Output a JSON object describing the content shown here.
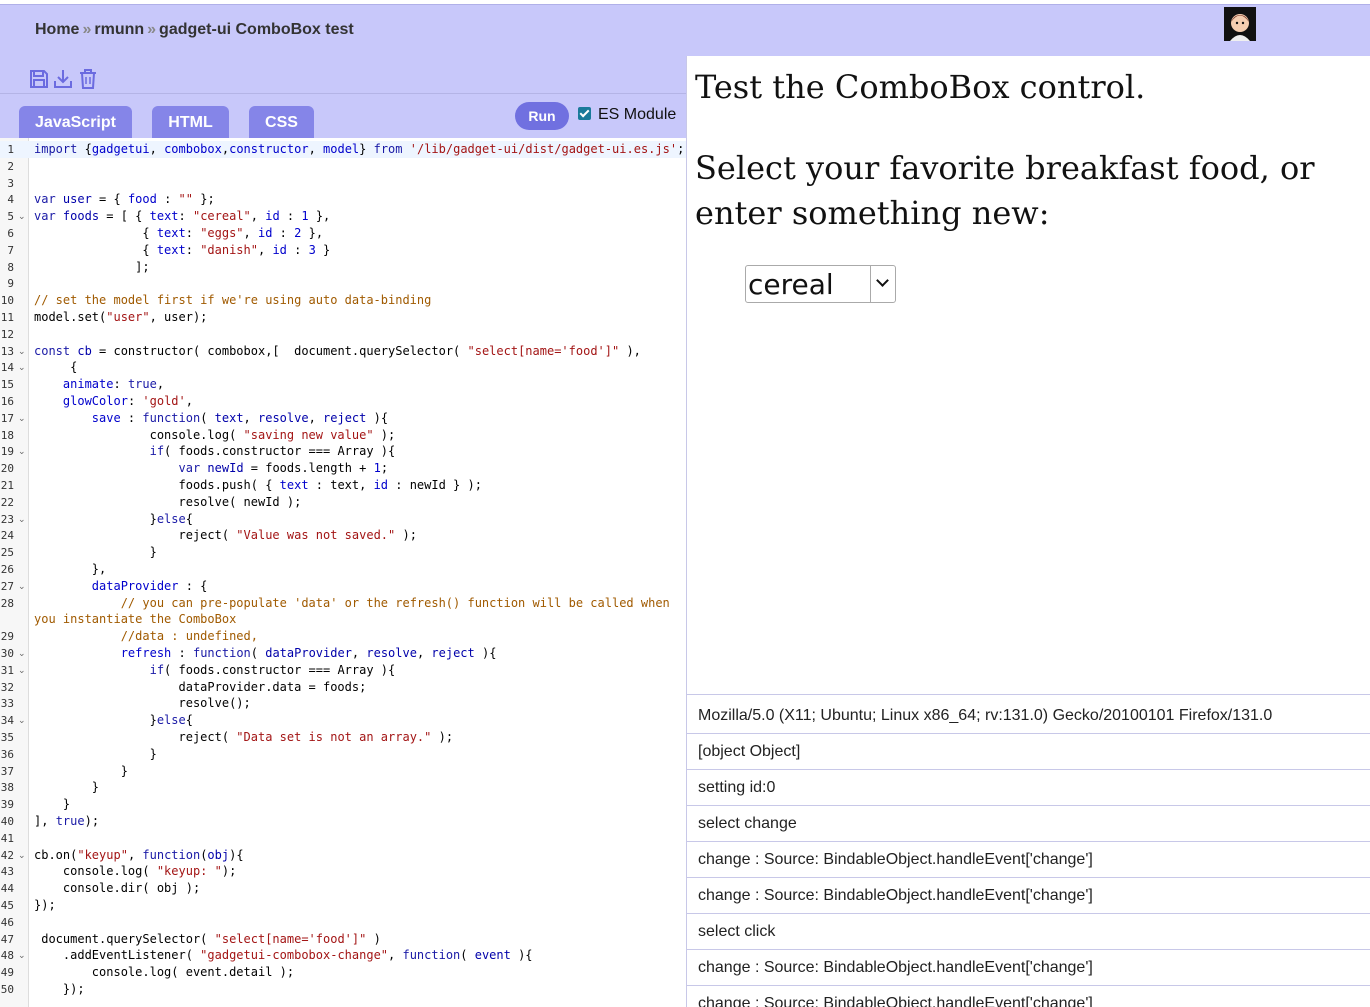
{
  "breadcrumb": {
    "home": "Home",
    "user": "rmunn",
    "title": "gadget-ui ComboBox test",
    "sep": "»"
  },
  "icons": {
    "save": "save-icon",
    "download": "download-icon",
    "delete": "trash-icon"
  },
  "tabs": [
    {
      "label": "JavaScript"
    },
    {
      "label": "HTML"
    },
    {
      "label": "CSS"
    }
  ],
  "run_label": "Run",
  "es_module_label": "ES Module",
  "es_module_checked": true,
  "code_lines": [
    {
      "n": "1",
      "f": "",
      "h": "<span class='k'>import</span> {<span class='n'>gadgetui</span>, <span class='n'>combobox</span>,<span class='n'>constructor</span>, <span class='n'>model</span>} <span class='k'>from</span> <span class='s'>'/lib/gadget-ui/dist/gadget-ui.es.js'</span>;"
    },
    {
      "n": "2",
      "f": "",
      "h": ""
    },
    {
      "n": "3",
      "f": "",
      "h": ""
    },
    {
      "n": "4",
      "f": "",
      "h": "<span class='k'>var</span> <span class='v'>user</span> = { <span class='n'>food</span> : <span class='s'>\"\"</span> };"
    },
    {
      "n": "5",
      "f": "⌄",
      "h": "<span class='k'>var</span> <span class='v'>foods</span> = [ { <span class='n'>text</span>: <span class='s'>\"cereal\"</span>, <span class='n'>id</span> : <span class='n'>1</span> },"
    },
    {
      "n": "6",
      "f": "",
      "h": "               { <span class='n'>text</span>: <span class='s'>\"eggs\"</span>, <span class='n'>id</span> : <span class='n'>2</span> },"
    },
    {
      "n": "7",
      "f": "",
      "h": "               { <span class='n'>text</span>: <span class='s'>\"danish\"</span>, <span class='n'>id</span> : <span class='n'>3</span> }"
    },
    {
      "n": "8",
      "f": "",
      "h": "              ];"
    },
    {
      "n": "9",
      "f": "",
      "h": ""
    },
    {
      "n": "10",
      "f": "",
      "h": "<span class='c'>// set the model first if we're using auto data-binding</span>"
    },
    {
      "n": "11",
      "f": "",
      "h": "model.set(<span class='s'>\"user\"</span>, user);"
    },
    {
      "n": "12",
      "f": "",
      "h": ""
    },
    {
      "n": "13",
      "f": "⌄",
      "h": "<span class='k'>const</span> <span class='v'>cb</span> = constructor( combobox,[  document.querySelector( <span class='s'>\"select[name='food']\"</span> ),"
    },
    {
      "n": "14",
      "f": "⌄",
      "h": "     {"
    },
    {
      "n": "15",
      "f": "",
      "h": "    <span class='n'>animate</span>: <span class='k'>true</span>,"
    },
    {
      "n": "16",
      "f": "",
      "h": "    <span class='n'>glowColor</span>: <span class='s'>'gold'</span>,"
    },
    {
      "n": "17",
      "f": "⌄",
      "h": "        <span class='n'>save</span> : <span class='k'>function</span>( <span class='v'>text</span>, <span class='v'>resolve</span>, <span class='v'>reject</span> ){"
    },
    {
      "n": "18",
      "f": "",
      "h": "                console.log( <span class='s'>\"saving new value\"</span> );"
    },
    {
      "n": "19",
      "f": "⌄",
      "h": "                <span class='k'>if</span>( foods.constructor === Array ){"
    },
    {
      "n": "20",
      "f": "",
      "h": "                    <span class='k'>var</span> <span class='v'>newId</span> = foods.length + <span class='n'>1</span>;"
    },
    {
      "n": "21",
      "f": "",
      "h": "                    foods.push( { <span class='n'>text</span> : text, <span class='n'>id</span> : newId } );"
    },
    {
      "n": "22",
      "f": "",
      "h": "                    resolve( newId );"
    },
    {
      "n": "23",
      "f": "⌄",
      "h": "                }<span class='k'>else</span>{"
    },
    {
      "n": "24",
      "f": "",
      "h": "                    reject( <span class='s'>\"Value was not saved.\"</span> );"
    },
    {
      "n": "25",
      "f": "",
      "h": "                }"
    },
    {
      "n": "26",
      "f": "",
      "h": "        },"
    },
    {
      "n": "27",
      "f": "⌄",
      "h": "        <span class='n'>dataProvider</span> : {"
    },
    {
      "n": "28",
      "f": "",
      "h": "            <span class='c'>// you can pre-populate 'data' or the refresh() function will be called when</span>"
    },
    {
      "n": "",
      "f": "",
      "h": "<span class='c'>you instantiate the ComboBox</span>"
    },
    {
      "n": "29",
      "f": "",
      "h": "            <span class='c'>//data : undefined,</span>"
    },
    {
      "n": "30",
      "f": "⌄",
      "h": "            <span class='n'>refresh</span> : <span class='k'>function</span>( <span class='v'>dataProvider</span>, <span class='v'>resolve</span>, <span class='v'>reject</span> ){"
    },
    {
      "n": "31",
      "f": "⌄",
      "h": "                <span class='k'>if</span>( foods.constructor === Array ){"
    },
    {
      "n": "32",
      "f": "",
      "h": "                    dataProvider.data = foods;"
    },
    {
      "n": "33",
      "f": "",
      "h": "                    resolve();"
    },
    {
      "n": "34",
      "f": "⌄",
      "h": "                }<span class='k'>else</span>{"
    },
    {
      "n": "35",
      "f": "",
      "h": "                    reject( <span class='s'>\"Data set is not an array.\"</span> );"
    },
    {
      "n": "36",
      "f": "",
      "h": "                }"
    },
    {
      "n": "37",
      "f": "",
      "h": "            }"
    },
    {
      "n": "38",
      "f": "",
      "h": "        }"
    },
    {
      "n": "39",
      "f": "",
      "h": "    }"
    },
    {
      "n": "40",
      "f": "",
      "h": "], <span class='k'>true</span>);"
    },
    {
      "n": "41",
      "f": "",
      "h": ""
    },
    {
      "n": "42",
      "f": "⌄",
      "h": "cb.on(<span class='s'>\"keyup\"</span>, <span class='k'>function</span>(<span class='v'>obj</span>){"
    },
    {
      "n": "43",
      "f": "",
      "h": "    console.log( <span class='s'>\"keyup: \"</span>);"
    },
    {
      "n": "44",
      "f": "",
      "h": "    console.dir( obj );"
    },
    {
      "n": "45",
      "f": "",
      "h": "});"
    },
    {
      "n": "46",
      "f": "",
      "h": ""
    },
    {
      "n": "47",
      "f": "",
      "h": " document.querySelector( <span class='s'>\"select[name='food']\"</span> )"
    },
    {
      "n": "48",
      "f": "⌄",
      "h": "    .addEventListener( <span class='s'>\"gadgetui-combobox-change\"</span>, <span class='k'>function</span>( <span class='v'>event</span> ){"
    },
    {
      "n": "49",
      "f": "",
      "h": "        console.log( event.detail );"
    },
    {
      "n": "50",
      "f": "",
      "h": "    });"
    }
  ],
  "preview": {
    "heading": "Test the ComboBox control.",
    "prompt": "Select your favorite breakfast food, or enter something new:",
    "combo_value": "cereal"
  },
  "log": [
    "Mozilla/5.0 (X11; Ubuntu; Linux x86_64; rv:131.0) Gecko/20100101 Firefox/131.0",
    "[object Object]",
    "setting id:0",
    "select change",
    "change : Source: BindableObject.handleEvent['change']",
    "change : Source: BindableObject.handleEvent['change']",
    "select click",
    "change : Source: BindableObject.handleEvent['change']",
    "change : Source: BindableObject.handleEvent['change']"
  ]
}
